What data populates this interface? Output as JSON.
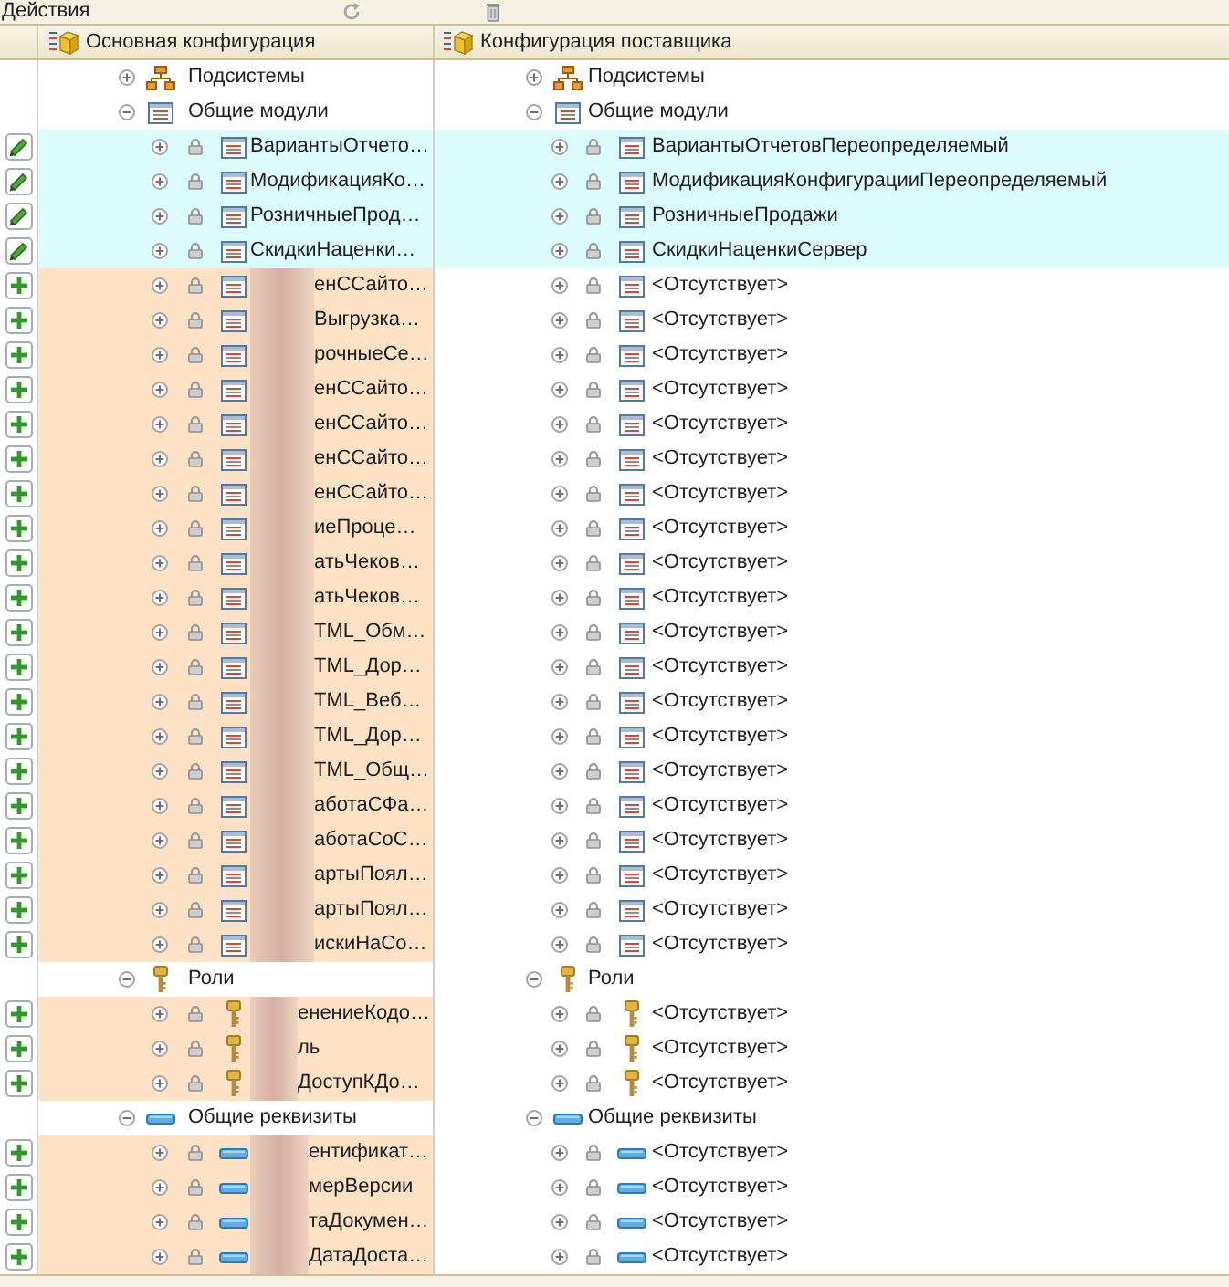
{
  "toolbar": {
    "actions_label": "Действия"
  },
  "columns": [
    {
      "title": "Основная конфигурация"
    },
    {
      "title": "Конфигурация поставщика"
    }
  ],
  "tree": [
    {
      "kind": "subsystems",
      "expanded": false,
      "main": "Подсистемы",
      "supplier": "Подсистемы"
    },
    {
      "kind": "modules",
      "expanded": true,
      "main": "Общие модули",
      "supplier": "Общие модули",
      "children": [
        {
          "kind": "modified",
          "expanded": false,
          "locked": true,
          "redacted": false,
          "main": "ВариантыОтчето…",
          "supplier": "ВариантыОтчетовПереопределяемый"
        },
        {
          "kind": "modified",
          "expanded": false,
          "locked": true,
          "redacted": false,
          "main": "МодификацияКо…",
          "supplier": "МодификацияКонфигурацииПереопределяемый"
        },
        {
          "kind": "modified",
          "expanded": false,
          "locked": true,
          "redacted": false,
          "main": "РозничныеПрод…",
          "supplier": "РозничныеПродажи"
        },
        {
          "kind": "modified",
          "expanded": false,
          "locked": true,
          "redacted": false,
          "main": "СкидкиНаценки…",
          "supplier": "СкидкиНаценкиСервер"
        },
        {
          "kind": "added",
          "expanded": false,
          "locked": true,
          "redacted": true,
          "main": "енССайто…",
          "supplier": "<Отсутствует>"
        },
        {
          "kind": "added",
          "expanded": false,
          "locked": true,
          "redacted": true,
          "main": "Выгрузка…",
          "supplier": "<Отсутствует>"
        },
        {
          "kind": "added",
          "expanded": false,
          "locked": true,
          "redacted": true,
          "main": "рочныеСе…",
          "supplier": "<Отсутствует>"
        },
        {
          "kind": "added",
          "expanded": false,
          "locked": true,
          "redacted": true,
          "main": "енССайто…",
          "supplier": "<Отсутствует>"
        },
        {
          "kind": "added",
          "expanded": false,
          "locked": true,
          "redacted": true,
          "main": "енССайто…",
          "supplier": "<Отсутствует>"
        },
        {
          "kind": "added",
          "expanded": false,
          "locked": true,
          "redacted": true,
          "main": "енССайто…",
          "supplier": "<Отсутствует>"
        },
        {
          "kind": "added",
          "expanded": false,
          "locked": true,
          "redacted": true,
          "main": "енССайто…",
          "supplier": "<Отсутствует>"
        },
        {
          "kind": "added",
          "expanded": false,
          "locked": true,
          "redacted": true,
          "main": "иеПроце…",
          "supplier": "<Отсутствует>"
        },
        {
          "kind": "added",
          "expanded": false,
          "locked": true,
          "redacted": true,
          "main": "атьЧеков…",
          "supplier": "<Отсутствует>"
        },
        {
          "kind": "added",
          "expanded": false,
          "locked": true,
          "redacted": true,
          "main": "атьЧеков…",
          "supplier": "<Отсутствует>"
        },
        {
          "kind": "added",
          "expanded": false,
          "locked": true,
          "redacted": true,
          "main": "TML_Обм…",
          "supplier": "<Отсутствует>"
        },
        {
          "kind": "added",
          "expanded": false,
          "locked": true,
          "redacted": true,
          "main": "TML_Дор…",
          "supplier": "<Отсутствует>"
        },
        {
          "kind": "added",
          "expanded": false,
          "locked": true,
          "redacted": true,
          "main": "TML_Веб…",
          "supplier": "<Отсутствует>"
        },
        {
          "kind": "added",
          "expanded": false,
          "locked": true,
          "redacted": true,
          "main": "TML_Дор…",
          "supplier": "<Отсутствует>"
        },
        {
          "kind": "added",
          "expanded": false,
          "locked": true,
          "redacted": true,
          "main": "TML_Общ…",
          "supplier": "<Отсутствует>"
        },
        {
          "kind": "added",
          "expanded": false,
          "locked": true,
          "redacted": true,
          "main": "аботаСФа…",
          "supplier": "<Отсутствует>"
        },
        {
          "kind": "added",
          "expanded": false,
          "locked": true,
          "redacted": true,
          "main": "аботаСоС…",
          "supplier": "<Отсутствует>"
        },
        {
          "kind": "added",
          "expanded": false,
          "locked": true,
          "redacted": true,
          "main": "артыПоял…",
          "supplier": "<Отсутствует>"
        },
        {
          "kind": "added",
          "expanded": false,
          "locked": true,
          "redacted": true,
          "main": "артыПоял…",
          "supplier": "<Отсутствует>"
        },
        {
          "kind": "added",
          "expanded": false,
          "locked": true,
          "redacted": true,
          "main": "искиНаСо…",
          "supplier": "<Отсутствует>"
        }
      ]
    },
    {
      "kind": "roles",
      "expanded": true,
      "main": "Роли",
      "supplier": "Роли",
      "children": [
        {
          "kind": "added",
          "expanded": false,
          "locked": true,
          "redacted": true,
          "main": "енениеКодо…",
          "supplier": "<Отсутствует>"
        },
        {
          "kind": "added",
          "expanded": false,
          "locked": true,
          "redacted": true,
          "main": "ль",
          "supplier": "<Отсутствует>"
        },
        {
          "kind": "added",
          "expanded": false,
          "locked": true,
          "redacted": true,
          "main": "ДоступКДо…",
          "supplier": "<Отсутствует>"
        }
      ]
    },
    {
      "kind": "attributes",
      "expanded": true,
      "main": "Общие реквизиты",
      "supplier": "Общие реквизиты",
      "children": [
        {
          "kind": "added",
          "expanded": false,
          "locked": true,
          "redacted": true,
          "main": "ентификат…",
          "supplier": "<Отсутствует>"
        },
        {
          "kind": "added",
          "expanded": false,
          "locked": true,
          "redacted": true,
          "main": "мерВерсии",
          "supplier": "<Отсутствует>"
        },
        {
          "kind": "added",
          "expanded": false,
          "locked": true,
          "redacted": true,
          "main": "таДокумен…",
          "supplier": "<Отсутствует>"
        },
        {
          "kind": "added",
          "expanded": false,
          "locked": true,
          "redacted": true,
          "main": "ДатаДоста…",
          "supplier": "<Отсутствует>"
        }
      ]
    }
  ]
}
